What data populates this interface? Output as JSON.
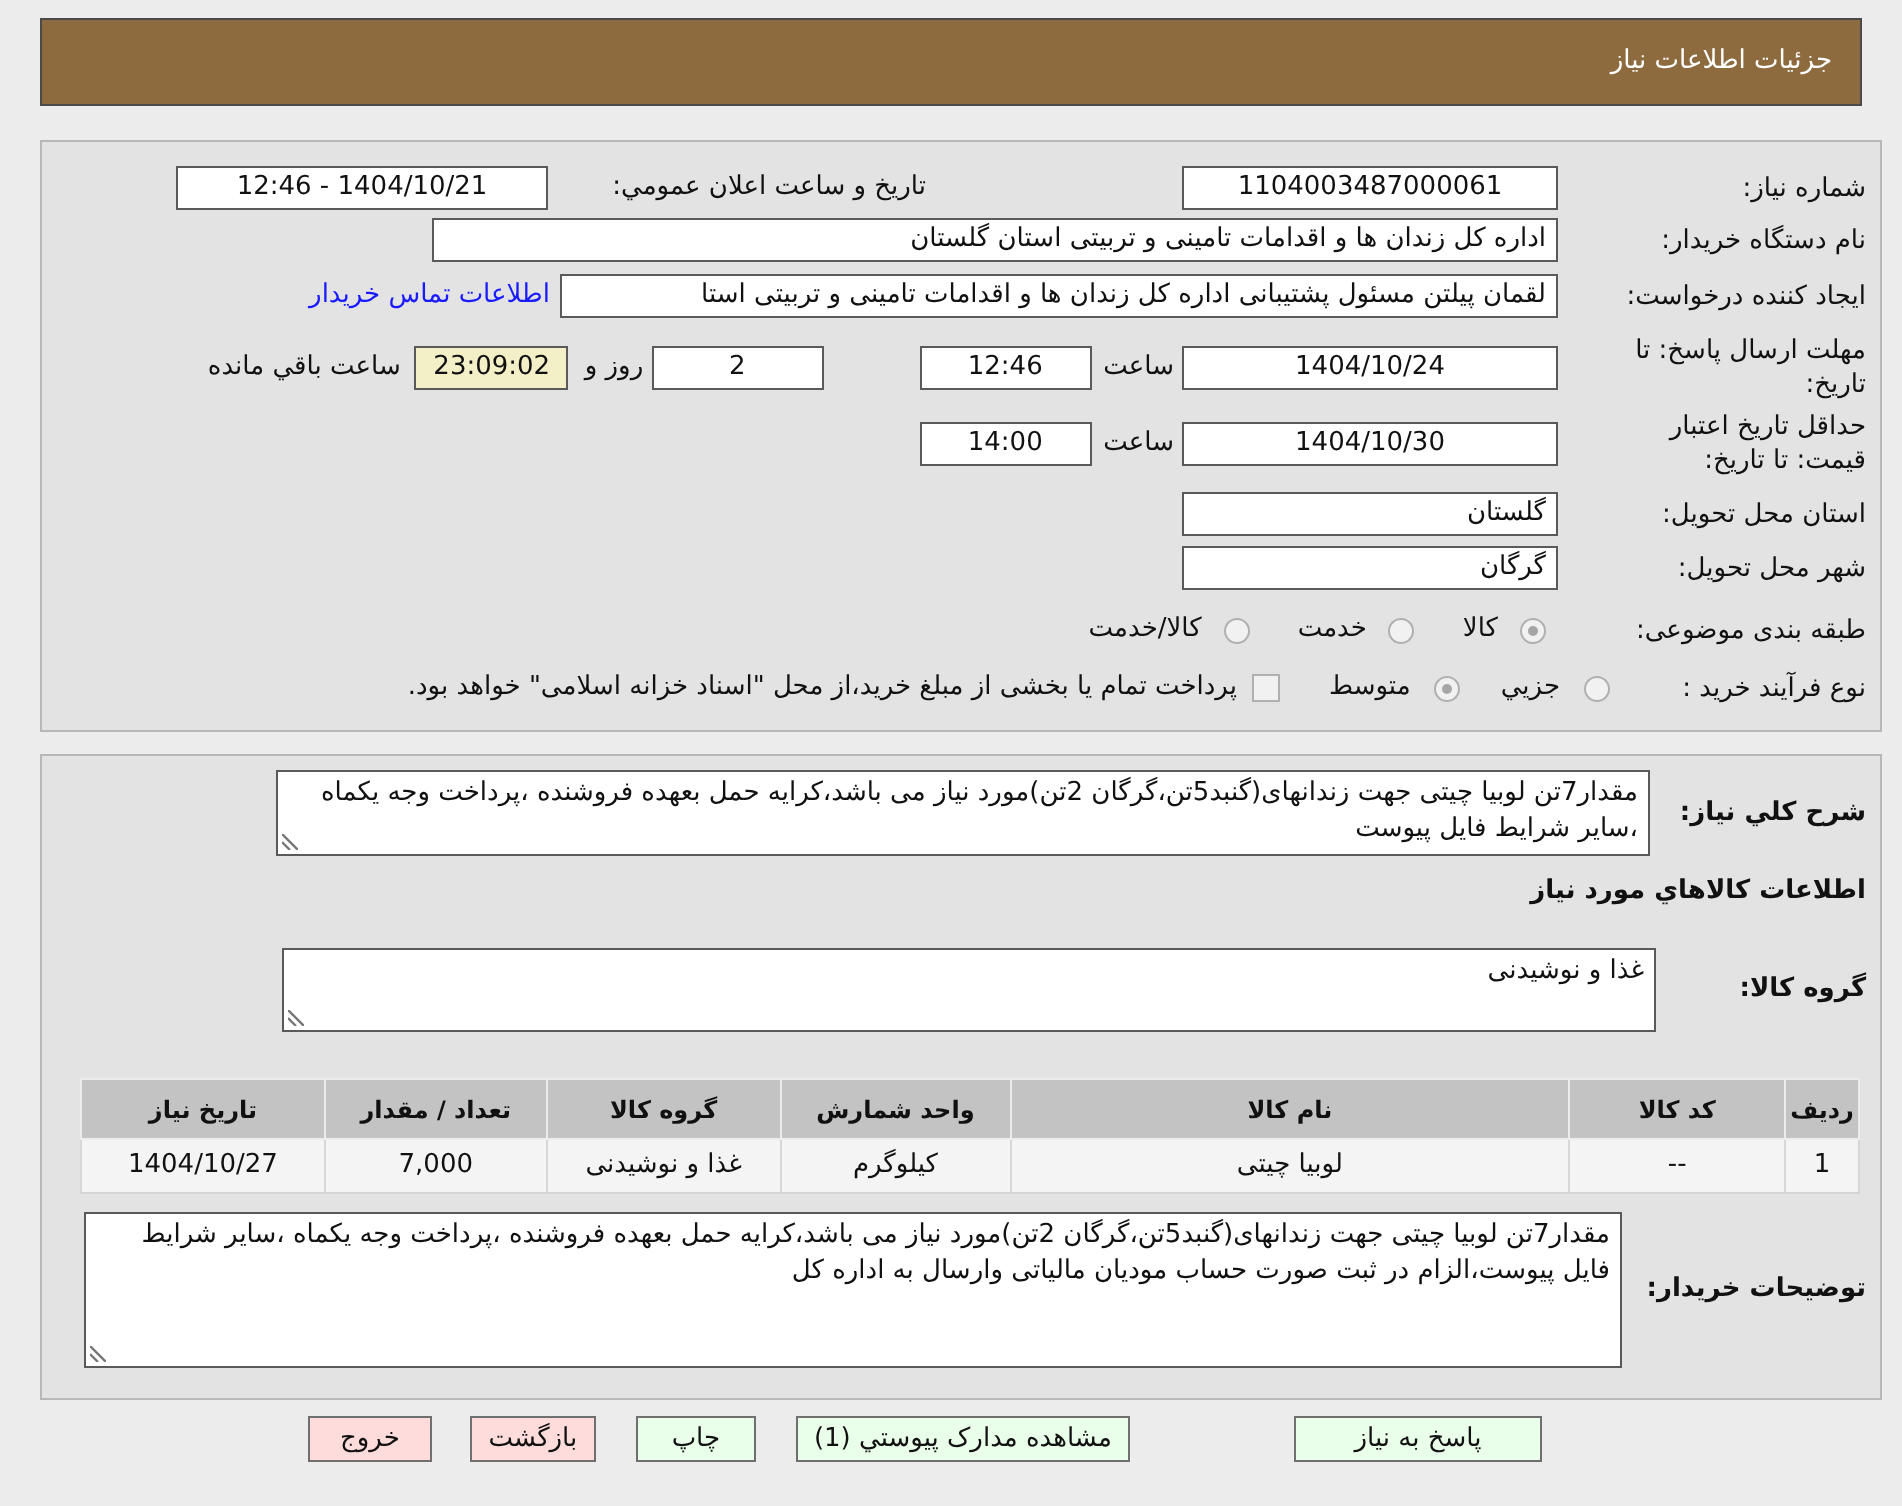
{
  "header": {
    "title": "جزئیات اطلاعات نیاز"
  },
  "summary": {
    "need_number": {
      "label": "شماره نیاز:",
      "value": "1104003487000061"
    },
    "announcement": {
      "label": "تاریخ و ساعت اعلان عمومي:",
      "value": "1404/10/21 - 12:46"
    },
    "buyer_org": {
      "label": "نام دستگاه خریدار:",
      "value": "اداره کل زندان ها و اقدامات تامینی و تربیتی استان گلستان"
    },
    "requester": {
      "label": "ایجاد کننده درخواست:",
      "value": "لقمان پیلتن مسئول پشتیبانی اداره کل زندان ها و اقدامات تامینی و تربیتی استا",
      "link": "اطلاعات تماس خریدار"
    },
    "response_deadline": {
      "label": "مهلت ارسال پاسخ: تا تاریخ:",
      "date": "1404/10/24",
      "time_label": "ساعت",
      "time": "12:46",
      "days": "2",
      "days_label": "روز و",
      "remaining": "23:09:02",
      "remaining_label": "ساعت باقي مانده"
    },
    "price_validity": {
      "label": "حداقل تاریخ اعتبار قیمت: تا تاریخ:",
      "date": "1404/10/30",
      "time_label": "ساعت",
      "time": "14:00"
    },
    "delivery_province": {
      "label": "استان محل تحویل:",
      "value": "گلستان"
    },
    "delivery_city": {
      "label": "شهر محل تحویل:",
      "value": "گرگان"
    },
    "category": {
      "label": "طبقه بندی موضوعی:",
      "options": [
        {
          "label": "کالا",
          "selected": true,
          "disabled": true
        },
        {
          "label": "خدمت",
          "selected": false,
          "disabled": true
        },
        {
          "label": "کالا/خدمت",
          "selected": false,
          "disabled": true
        }
      ]
    },
    "purchase_process": {
      "label": "نوع فرآیند خرید :",
      "options": [
        {
          "label": "جزيي",
          "selected": false,
          "disabled": true
        },
        {
          "label": "متوسط",
          "selected": true,
          "disabled": true
        }
      ],
      "treasury_option": {
        "label": "پرداخت تمام یا بخشی از مبلغ خرید،از محل \"اسناد خزانه اسلامی\" خواهد بود.",
        "checked": false,
        "disabled": true
      }
    }
  },
  "requirements": {
    "description": {
      "label": "شرح کلي نیاز:",
      "value": "مقدار7تن لوبیا چیتی جهت زندانهای(گنبد5تن،گرگان 2تن)مورد نیاز می باشد،کرایه حمل بعهده فروشنده ،پرداخت وجه یکماه ،سایر شرایط فایل پیوست"
    },
    "goods_heading": "اطلاعات کالاهاي مورد نیاز",
    "goods_group": {
      "label": "گروه کالا:",
      "value": "غذا و نوشیدنی"
    },
    "table": {
      "columns": [
        "ردیف",
        "کد کالا",
        "نام کالا",
        "واحد شمارش",
        "گروه کالا",
        "تعداد / مقدار",
        "تاریخ نیاز"
      ],
      "rows": [
        [
          "1",
          "--",
          "لوبیا چیتی",
          "کیلوگرم",
          "غذا و نوشیدنی",
          "7,000",
          "1404/10/27"
        ]
      ]
    },
    "buyer_notes": {
      "label": "توضیحات خریدار:",
      "value": "مقدار7تن لوبیا چیتی جهت زندانهای(گنبد5تن،گرگان 2تن)مورد نیاز می باشد،کرایه حمل بعهده فروشنده ،پرداخت وجه یکماه ،سایر شرایط فایل پیوست،الزام در ثبت صورت حساب مودیان مالیاتی وارسال به اداره کل"
    }
  },
  "buttons": [
    {
      "label": "پاسخ به نیاز",
      "color": "#eaffea"
    },
    {
      "label": "مشاهده مدارک پیوستي (1)",
      "color": "#eaffea"
    },
    {
      "label": "چاپ",
      "color": "#eaffea"
    },
    {
      "label": "بازگشت",
      "color": "#ffdcdc"
    },
    {
      "label": "خروج",
      "color": "#ffdcdc"
    }
  ]
}
